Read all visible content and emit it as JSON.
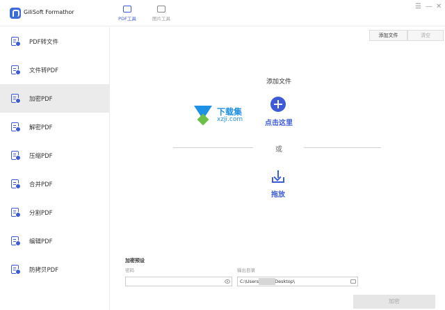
{
  "app": {
    "title": "GiliSoft Formathor"
  },
  "tabs": [
    {
      "label": "PDF工具",
      "active": true
    },
    {
      "label": "图片工具",
      "active": false
    }
  ],
  "window_controls": {
    "menu": "☰",
    "minimize": "—",
    "close": "✕"
  },
  "sidebar": {
    "items": [
      {
        "label": "PDF转文件"
      },
      {
        "label": "文件转PDF"
      },
      {
        "label": "加密PDF",
        "active": true
      },
      {
        "label": "解密PDF"
      },
      {
        "label": "压缩PDF"
      },
      {
        "label": "合并PDF"
      },
      {
        "label": "分割PDF"
      },
      {
        "label": "编辑PDF"
      },
      {
        "label": "防拷贝PDF"
      }
    ]
  },
  "toolbar": {
    "add_file": "添加文件",
    "clear": "清空"
  },
  "dropzone": {
    "title": "添加文件",
    "click_here": "点击这里",
    "or": "或",
    "drag": "拖放"
  },
  "watermark": {
    "cn": "下载集",
    "en": "xzji.com"
  },
  "settings": {
    "title": "加密预设",
    "password_label": "密码",
    "password_value": "",
    "output_label": "输出目录",
    "output_value": "C:\\Users\\         \\Desktop\\"
  },
  "encrypt_button": "加密",
  "colors": {
    "accent": "#3d5bd8",
    "active_item_bg": "#ebebeb"
  }
}
